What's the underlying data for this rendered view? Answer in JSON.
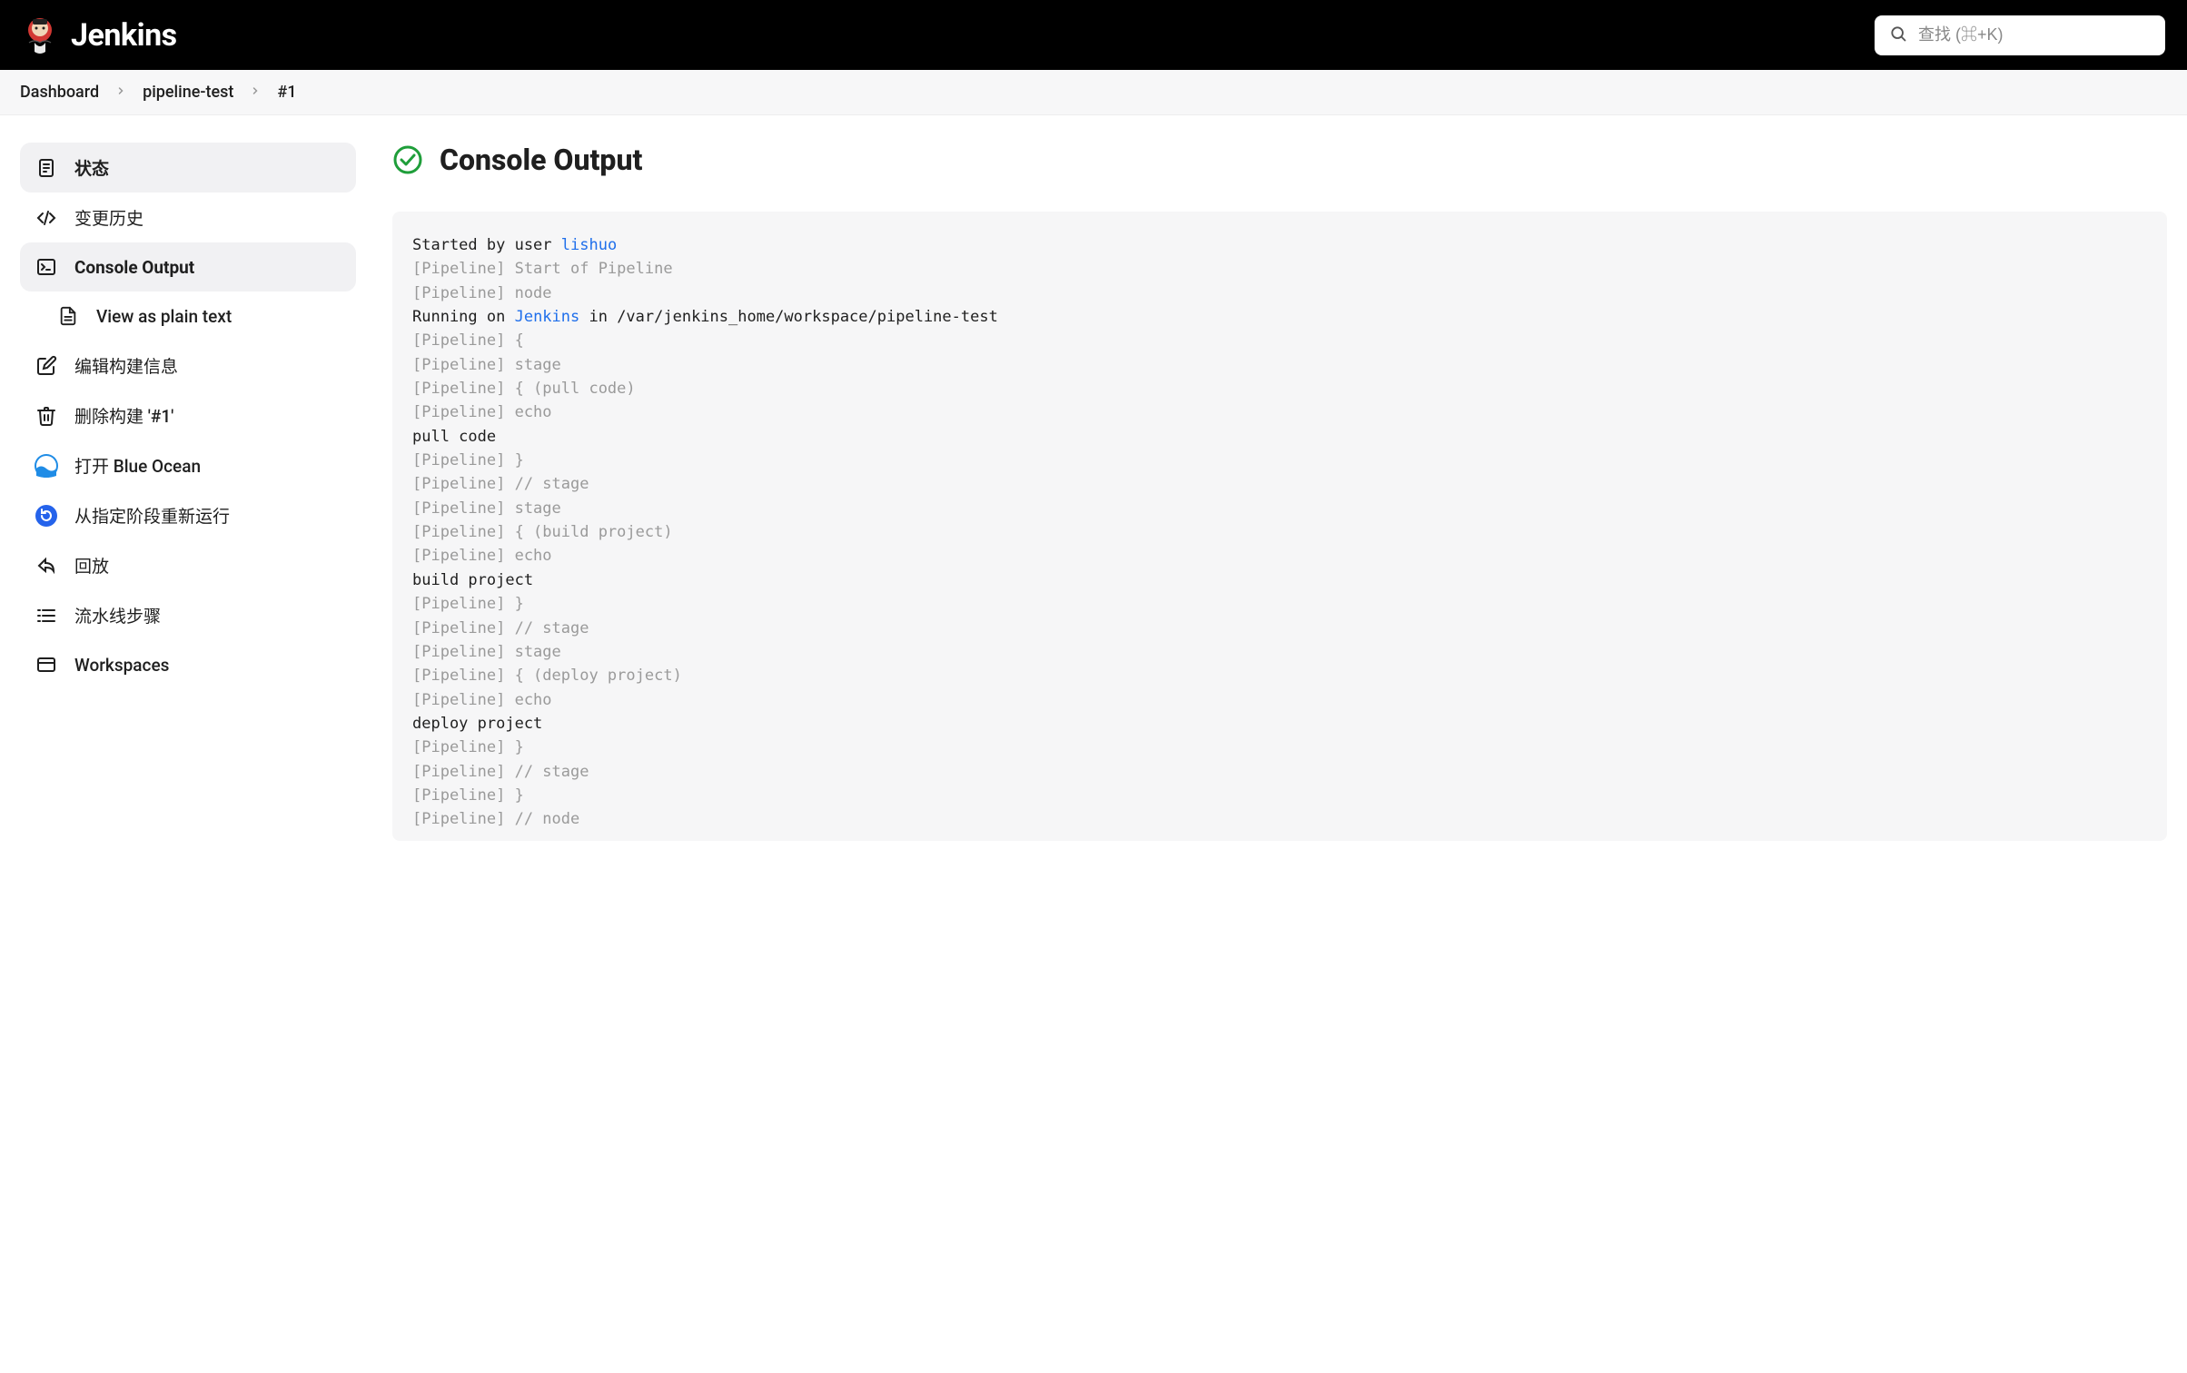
{
  "header": {
    "brand": "Jenkins",
    "search_placeholder": "查找 (⌘+K)"
  },
  "breadcrumb": {
    "items": [
      "Dashboard",
      "pipeline-test",
      "#1"
    ]
  },
  "sidebar": {
    "items": [
      {
        "label": "状态"
      },
      {
        "label": "变更历史"
      },
      {
        "label": "Console Output"
      },
      {
        "label": "View as plain text"
      },
      {
        "label": "编辑构建信息"
      },
      {
        "label": "删除构建 '#1'"
      },
      {
        "label": "打开 Blue Ocean"
      },
      {
        "label": "从指定阶段重新运行"
      },
      {
        "label": "回放"
      },
      {
        "label": "流水线步骤"
      },
      {
        "label": "Workspaces"
      }
    ]
  },
  "main": {
    "title": "Console Output",
    "console": [
      {
        "type": "mixed",
        "segments": [
          {
            "text": "Started by user ",
            "cls": "normal"
          },
          {
            "text": "lishuo",
            "cls": "link"
          }
        ]
      },
      {
        "type": "muted",
        "text": "[Pipeline] Start of Pipeline"
      },
      {
        "type": "muted",
        "text": "[Pipeline] node"
      },
      {
        "type": "mixed",
        "segments": [
          {
            "text": "Running on ",
            "cls": "normal"
          },
          {
            "text": "Jenkins",
            "cls": "link"
          },
          {
            "text": " in /var/jenkins_home/workspace/pipeline-test",
            "cls": "normal"
          }
        ]
      },
      {
        "type": "muted",
        "text": "[Pipeline] {"
      },
      {
        "type": "muted",
        "text": "[Pipeline] stage"
      },
      {
        "type": "muted",
        "text": "[Pipeline] { (pull code)"
      },
      {
        "type": "muted",
        "text": "[Pipeline] echo"
      },
      {
        "type": "normal",
        "text": "pull code"
      },
      {
        "type": "muted",
        "text": "[Pipeline] }"
      },
      {
        "type": "muted",
        "text": "[Pipeline] // stage"
      },
      {
        "type": "muted",
        "text": "[Pipeline] stage"
      },
      {
        "type": "muted",
        "text": "[Pipeline] { (build project)"
      },
      {
        "type": "muted",
        "text": "[Pipeline] echo"
      },
      {
        "type": "normal",
        "text": "build project"
      },
      {
        "type": "muted",
        "text": "[Pipeline] }"
      },
      {
        "type": "muted",
        "text": "[Pipeline] // stage"
      },
      {
        "type": "muted",
        "text": "[Pipeline] stage"
      },
      {
        "type": "muted",
        "text": "[Pipeline] { (deploy project)"
      },
      {
        "type": "muted",
        "text": "[Pipeline] echo"
      },
      {
        "type": "normal",
        "text": "deploy project"
      },
      {
        "type": "muted",
        "text": "[Pipeline] }"
      },
      {
        "type": "muted",
        "text": "[Pipeline] // stage"
      },
      {
        "type": "muted",
        "text": "[Pipeline] }"
      },
      {
        "type": "muted",
        "text": "[Pipeline] // node"
      }
    ]
  }
}
